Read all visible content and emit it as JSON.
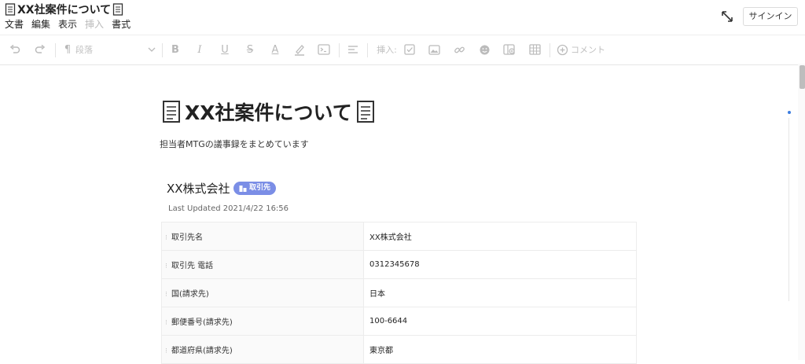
{
  "header": {
    "title": "XX社案件について",
    "title_icon": "document-icon",
    "menu": [
      {
        "label": "文書",
        "enabled": true
      },
      {
        "label": "編集",
        "enabled": true
      },
      {
        "label": "表示",
        "enabled": true
      },
      {
        "label": "挿入",
        "enabled": false
      },
      {
        "label": "書式",
        "enabled": true
      }
    ],
    "signin_label": "サインイン"
  },
  "toolbar": {
    "paragraph_label": "段落",
    "insert_label": "挿入:",
    "comment_label": "コメント",
    "icons": [
      "undo-icon",
      "redo-icon",
      "paragraph-icon",
      "chevron-down-icon",
      "bold-icon",
      "italic-icon",
      "underline-icon",
      "strikethrough-icon",
      "text-color-icon",
      "highlight-icon",
      "code-icon",
      "align-icon",
      "checkbox-icon",
      "image-icon",
      "link-icon",
      "emoji-icon",
      "embed-icon",
      "table-icon",
      "comment-icon"
    ]
  },
  "document": {
    "heading": "XX社案件について",
    "subtitle": "担当者MTGの議事録をまとめています",
    "record": {
      "title": "XX株式会社",
      "badge": "取引先",
      "badge_color": "#7b8ee6",
      "last_updated": "Last Updated 2021/4/22 16:56",
      "fields": [
        {
          "label": "取引先名",
          "value": "XX株式会社"
        },
        {
          "label": "取引先 電話",
          "value": "0312345678"
        },
        {
          "label": "国(請求先)",
          "value": "日本"
        },
        {
          "label": "郵便番号(請求先)",
          "value": "100-6644"
        },
        {
          "label": "都道府県(請求先)",
          "value": "東京都"
        }
      ]
    }
  },
  "colors": {
    "accent": "#3d7de0",
    "badge": "#7b8ee6"
  }
}
